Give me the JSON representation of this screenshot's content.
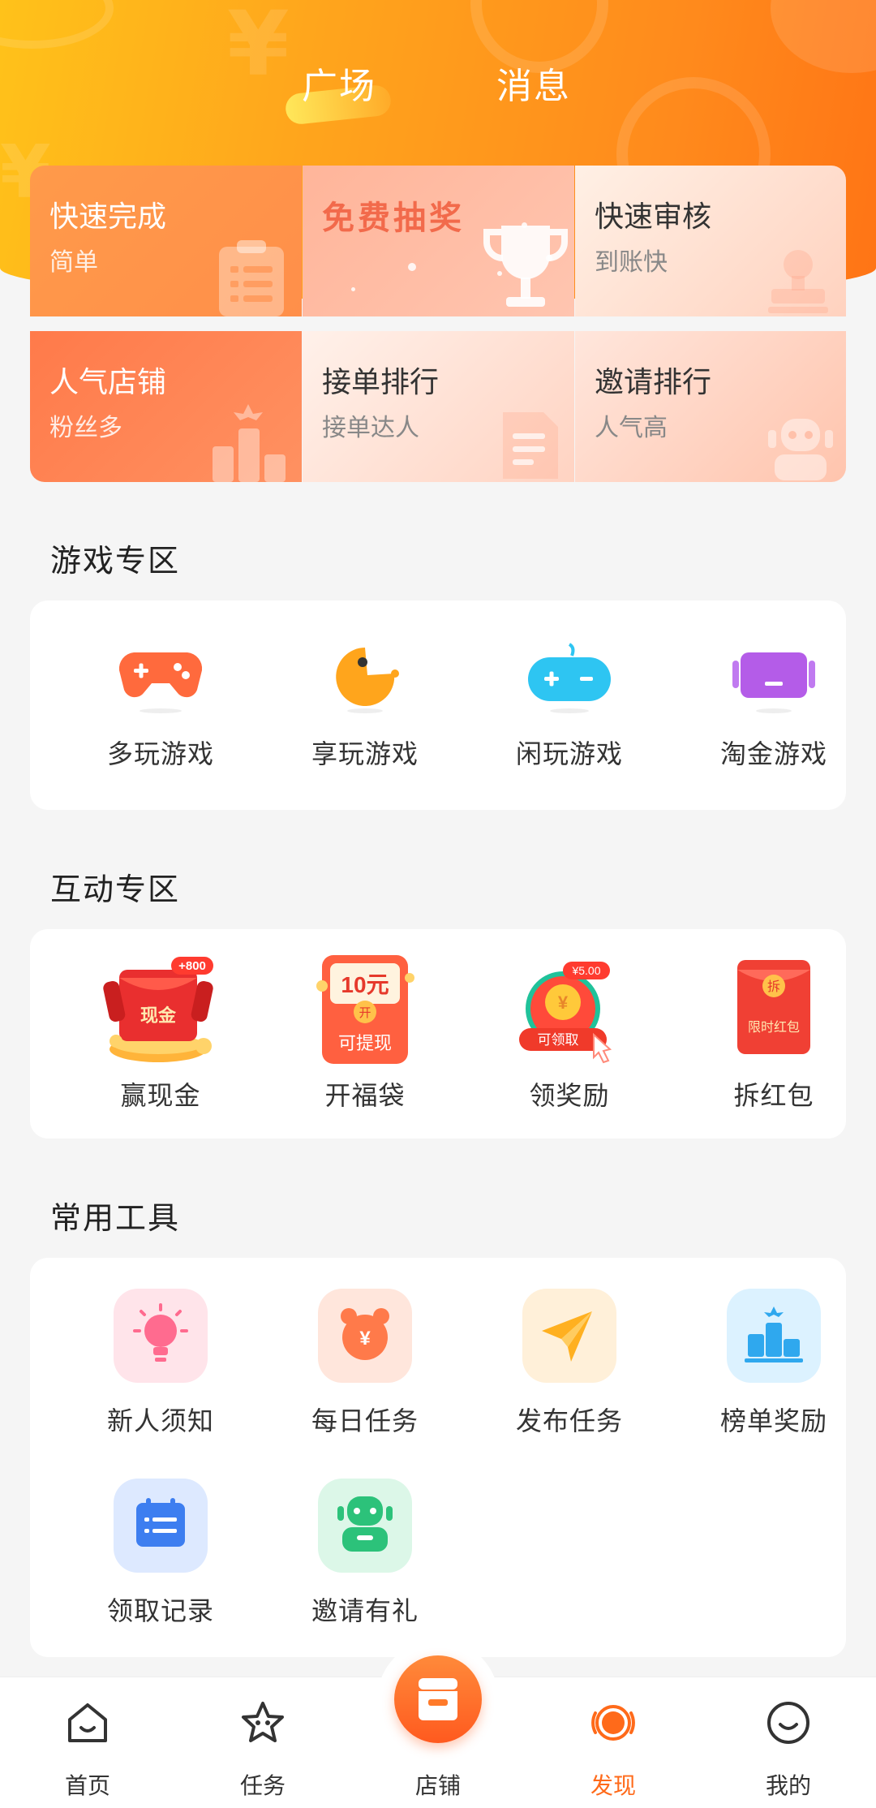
{
  "header": {
    "tabs": [
      {
        "label": "广场",
        "active": true
      },
      {
        "label": "消息",
        "active": false
      }
    ]
  },
  "features": [
    {
      "title": "快速完成",
      "subtitle": "简单",
      "icon": "clipboard-list-icon"
    },
    {
      "title": "免费抽奖",
      "subtitle": "",
      "icon": "trophy-icon"
    },
    {
      "title": "快速审核",
      "subtitle": "到账快",
      "icon": "stamp-icon"
    },
    {
      "title": "人气店铺",
      "subtitle": "粉丝多",
      "icon": "podium-icon"
    },
    {
      "title": "接单排行",
      "subtitle": "接单达人",
      "icon": "document-icon"
    },
    {
      "title": "邀请排行",
      "subtitle": "人气高",
      "icon": "robot-icon"
    }
  ],
  "sections": {
    "games": {
      "title": "游戏专区",
      "items": [
        {
          "label": "多玩游戏",
          "icon": "gamepad-icon",
          "color": "#ff6a3d"
        },
        {
          "label": "享玩游戏",
          "icon": "pacman-icon",
          "color": "#ffa51c"
        },
        {
          "label": "闲玩游戏",
          "icon": "controller-icon",
          "color": "#2ec5f2"
        },
        {
          "label": "淘金游戏",
          "icon": "handheld-console-icon",
          "color": "#b45ce8"
        }
      ]
    },
    "interactive": {
      "title": "互动专区",
      "items": [
        {
          "label": "赢现金",
          "icon": "cash-redpacket-icon",
          "badge": "+800",
          "inner": "现金"
        },
        {
          "label": "开福袋",
          "icon": "lucky-bag-icon",
          "badge": "",
          "inner_top": "10元",
          "inner_mid": "开",
          "inner": "可提现"
        },
        {
          "label": "领奖励",
          "icon": "reward-coin-icon",
          "badge": "¥5.00",
          "inner": "可领取"
        },
        {
          "label": "拆红包",
          "icon": "red-packet-icon",
          "badge": "",
          "inner_mid": "拆",
          "inner": "限时红包"
        }
      ]
    },
    "tools": {
      "title": "常用工具",
      "items": [
        {
          "label": "新人须知",
          "icon": "lightbulb-icon",
          "color": "#ff6b8f"
        },
        {
          "label": "每日任务",
          "icon": "alarm-clock-icon",
          "color": "#ff7a4a"
        },
        {
          "label": "发布任务",
          "icon": "paper-plane-icon",
          "color": "#ffb020"
        },
        {
          "label": "榜单奖励",
          "icon": "ranking-icon",
          "color": "#2fa8ee"
        },
        {
          "label": "领取记录",
          "icon": "calendar-list-icon",
          "color": "#3d7ef0"
        },
        {
          "label": "邀请有礼",
          "icon": "invite-robot-icon",
          "color": "#2cc27a"
        }
      ]
    }
  },
  "bottom_nav": [
    {
      "label": "首页",
      "icon": "home-icon",
      "active": false
    },
    {
      "label": "任务",
      "icon": "star-icon",
      "active": false
    },
    {
      "label": "店铺",
      "icon": "store-icon",
      "active": false
    },
    {
      "label": "发现",
      "icon": "discover-icon",
      "active": true
    },
    {
      "label": "我的",
      "icon": "profile-icon",
      "active": false
    }
  ],
  "colors": {
    "accent": "#ff6a1a",
    "header_start": "#ffc21a",
    "header_end": "#ff7415"
  }
}
